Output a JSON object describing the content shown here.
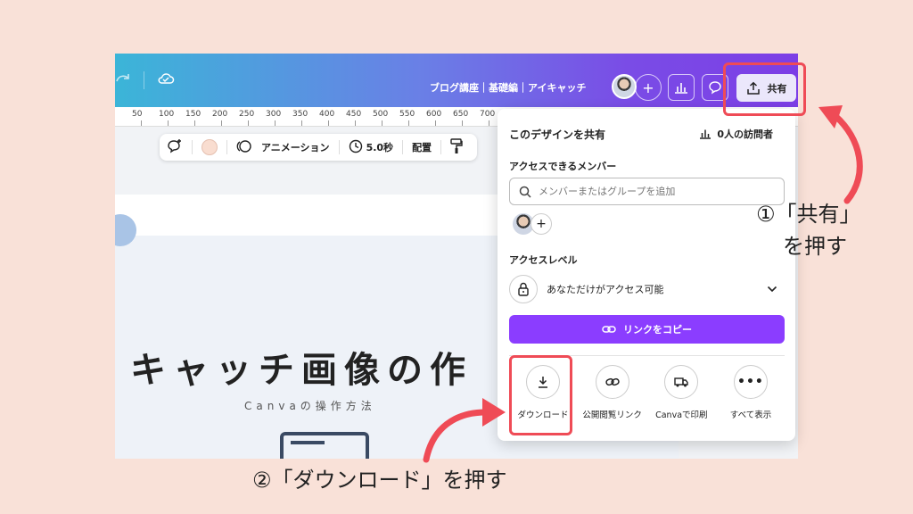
{
  "header": {
    "title": "ブログ講座｜基礎編｜アイキャッチ",
    "share_label": "共有"
  },
  "ruler": [
    "50",
    "100",
    "150",
    "200",
    "250",
    "300",
    "350",
    "400",
    "450",
    "500",
    "550",
    "600",
    "650",
    "700"
  ],
  "toolbar": {
    "animation_label": "アニメーション",
    "duration_label": "5.0秒",
    "position_label": "配置"
  },
  "canvas": {
    "title": "キャッチ画像の作",
    "subtitle": "Canvaの操作方法"
  },
  "share_panel": {
    "title": "このデザインを共有",
    "visitors": "0人の訪問者",
    "members_heading": "アクセスできるメンバー",
    "search_placeholder": "メンバーまたはグループを追加",
    "access_level_heading": "アクセスレベル",
    "access_level_value": "あなただけがアクセス可能",
    "copy_link_label": "リンクをコピー",
    "actions": [
      {
        "label": "ダウンロード",
        "icon": "download-icon"
      },
      {
        "label": "公開閲覧リンク",
        "icon": "link-icon"
      },
      {
        "label": "Canvaで印刷",
        "icon": "truck-icon"
      },
      {
        "label": "すべて表示",
        "icon": "more-icon"
      }
    ]
  },
  "annotations": {
    "step1_line1": "①「共有」",
    "step1_line2": "を押す",
    "step2": "②「ダウンロード」を押す"
  },
  "colors": {
    "background": "#f9e1d8",
    "highlight": "#ef4b56",
    "accent": "#8b3dff"
  }
}
